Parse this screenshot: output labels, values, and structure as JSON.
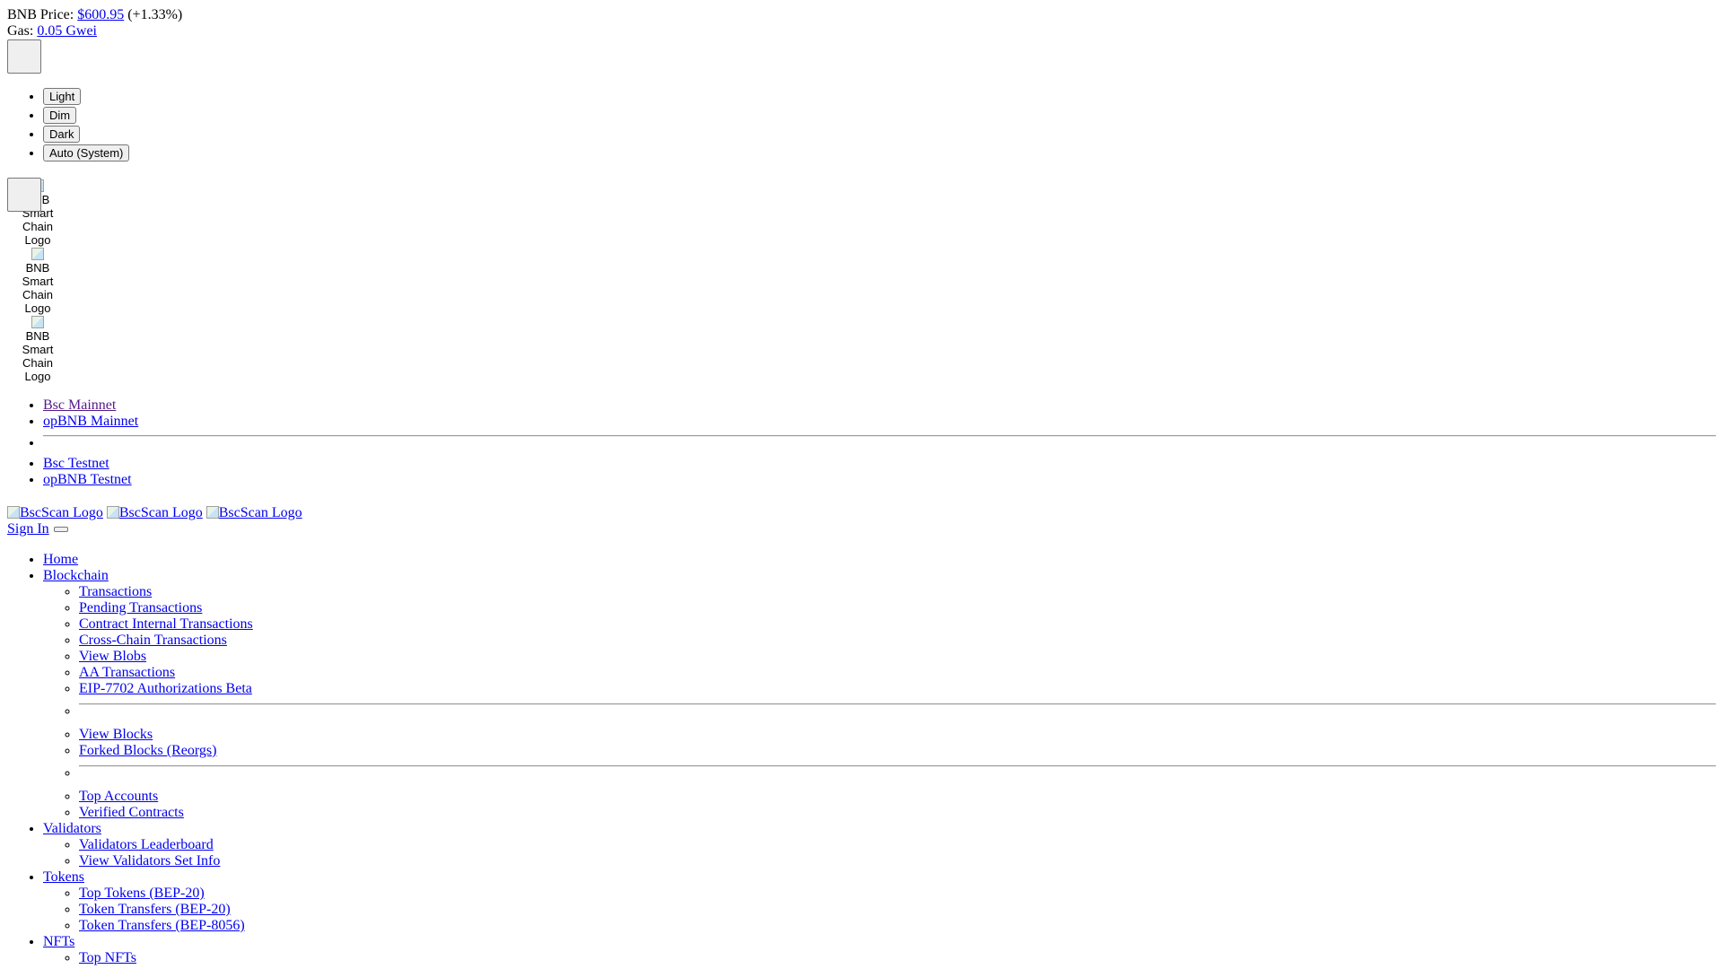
{
  "topbar": {
    "price_label": "BNB Price:",
    "price_value": "$600.95",
    "price_change": "(+1.33%)",
    "gas_label": "Gas:",
    "gas_value": "0.05 Gwei"
  },
  "theme_menu": {
    "options": [
      "Light",
      "Dim",
      "Dark",
      "Auto (System)"
    ]
  },
  "chain_logos": {
    "alt_text": "BNB Smart Chain Logo",
    "count": 3
  },
  "networks": {
    "mainnets": [
      "Bsc Mainnet",
      "opBNB Mainnet"
    ],
    "testnets": [
      "Bsc Testnet",
      "opBNB Testnet"
    ]
  },
  "brand": {
    "logo_alt": "BscScan Logo"
  },
  "auth": {
    "sign_in": "Sign In"
  },
  "nav": {
    "home": "Home",
    "blockchain": {
      "label": "Blockchain",
      "group1": [
        "Transactions",
        "Pending Transactions",
        "Contract Internal Transactions",
        "Cross-Chain Transactions",
        "View Blobs",
        "AA Transactions",
        "EIP-7702 Authorizations Beta"
      ],
      "group2": [
        "View Blocks",
        "Forked Blocks (Reorgs)"
      ],
      "group3": [
        "Top Accounts",
        "Verified Contracts"
      ]
    },
    "validators": {
      "label": "Validators",
      "items": [
        "Validators Leaderboard",
        "View Validators Set Info"
      ]
    },
    "tokens": {
      "label": "Tokens",
      "items": [
        "Top Tokens (BEP-20)",
        "Token Transfers (BEP-20)",
        "Token Transfers (BEP-8056)"
      ]
    },
    "nfts": {
      "label": "NFTs",
      "items": [
        "Top NFTs"
      ]
    }
  },
  "colors": {
    "link": "#0000ee",
    "visited_link": "#551a8b",
    "background": "#ffffff"
  }
}
